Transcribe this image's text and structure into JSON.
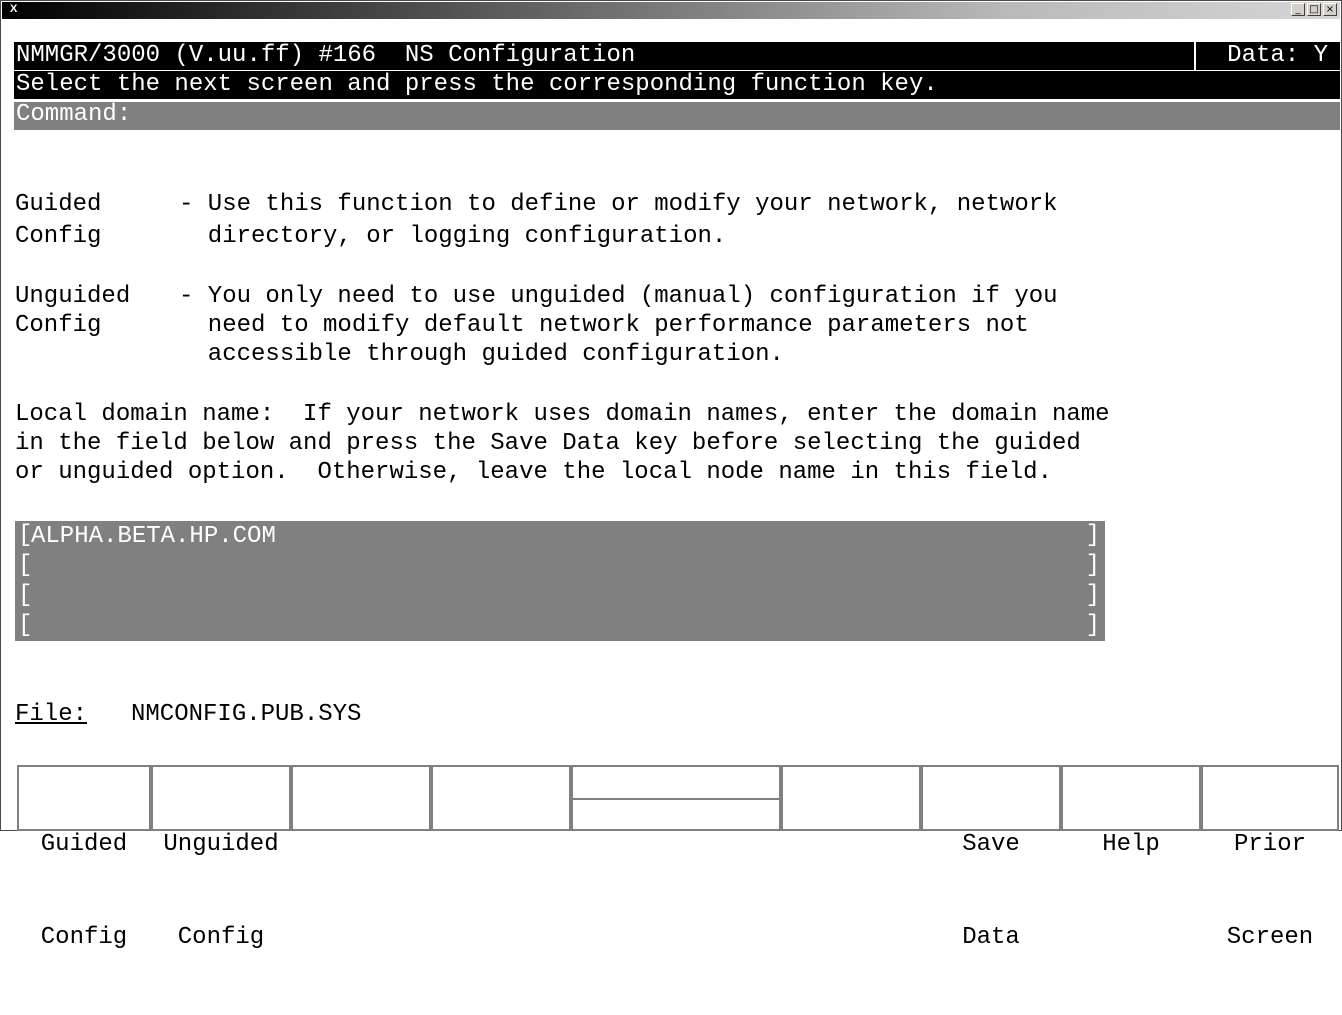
{
  "window": {
    "title_icon": "X",
    "controls": [
      "_",
      "□",
      "×"
    ]
  },
  "header": {
    "title": "NMMGR/3000 (V.uu.ff) #166  NS Configuration",
    "data_flag": "Data: Y"
  },
  "instruction": "Select the next screen and press the corresponding function key.",
  "command": {
    "label": "Command:",
    "value": ""
  },
  "options": [
    {
      "name_line1": "Guided",
      "name_line2": "Config",
      "desc_lines": [
        "- Use this function to define or modify your network, network",
        "  directory, or logging configuration."
      ]
    },
    {
      "name_line1": "Unguided",
      "name_line2": "Config",
      "desc_lines": [
        "- You only need to use unguided (manual) configuration if you",
        "  need to modify default network performance parameters not",
        "  accessible through guided configuration."
      ]
    }
  ],
  "domain_help": [
    "Local domain name:  If your network uses domain names, enter the domain name",
    "in the field below and press the Save Data key before selecting the guided",
    "or unguided option.  Otherwise, leave the local node name in this field."
  ],
  "domain_fields": {
    "open_bracket": "[",
    "close_bracket": "]",
    "values": [
      "ALPHA.BETA.HP.COM",
      "",
      "",
      ""
    ]
  },
  "file": {
    "label": "File:",
    "value": "NMCONFIG.PUB.SYS"
  },
  "function_keys": [
    {
      "line1": "Guided",
      "line2": "Config"
    },
    {
      "line1": "Unguided",
      "line2": "Config"
    },
    {
      "line1": "",
      "line2": ""
    },
    {
      "line1": "",
      "line2": ""
    },
    {
      "line1": "",
      "line2": ""
    },
    {
      "line1": "",
      "line2": ""
    },
    {
      "line1": "Save",
      "line2": "Data"
    },
    {
      "line1": "Help",
      "line2": ""
    },
    {
      "line1": "Prior",
      "line2": "Screen"
    }
  ],
  "colors": {
    "header_bg": "#000000",
    "field_bg": "#808080",
    "field_text": "#ffffff"
  }
}
